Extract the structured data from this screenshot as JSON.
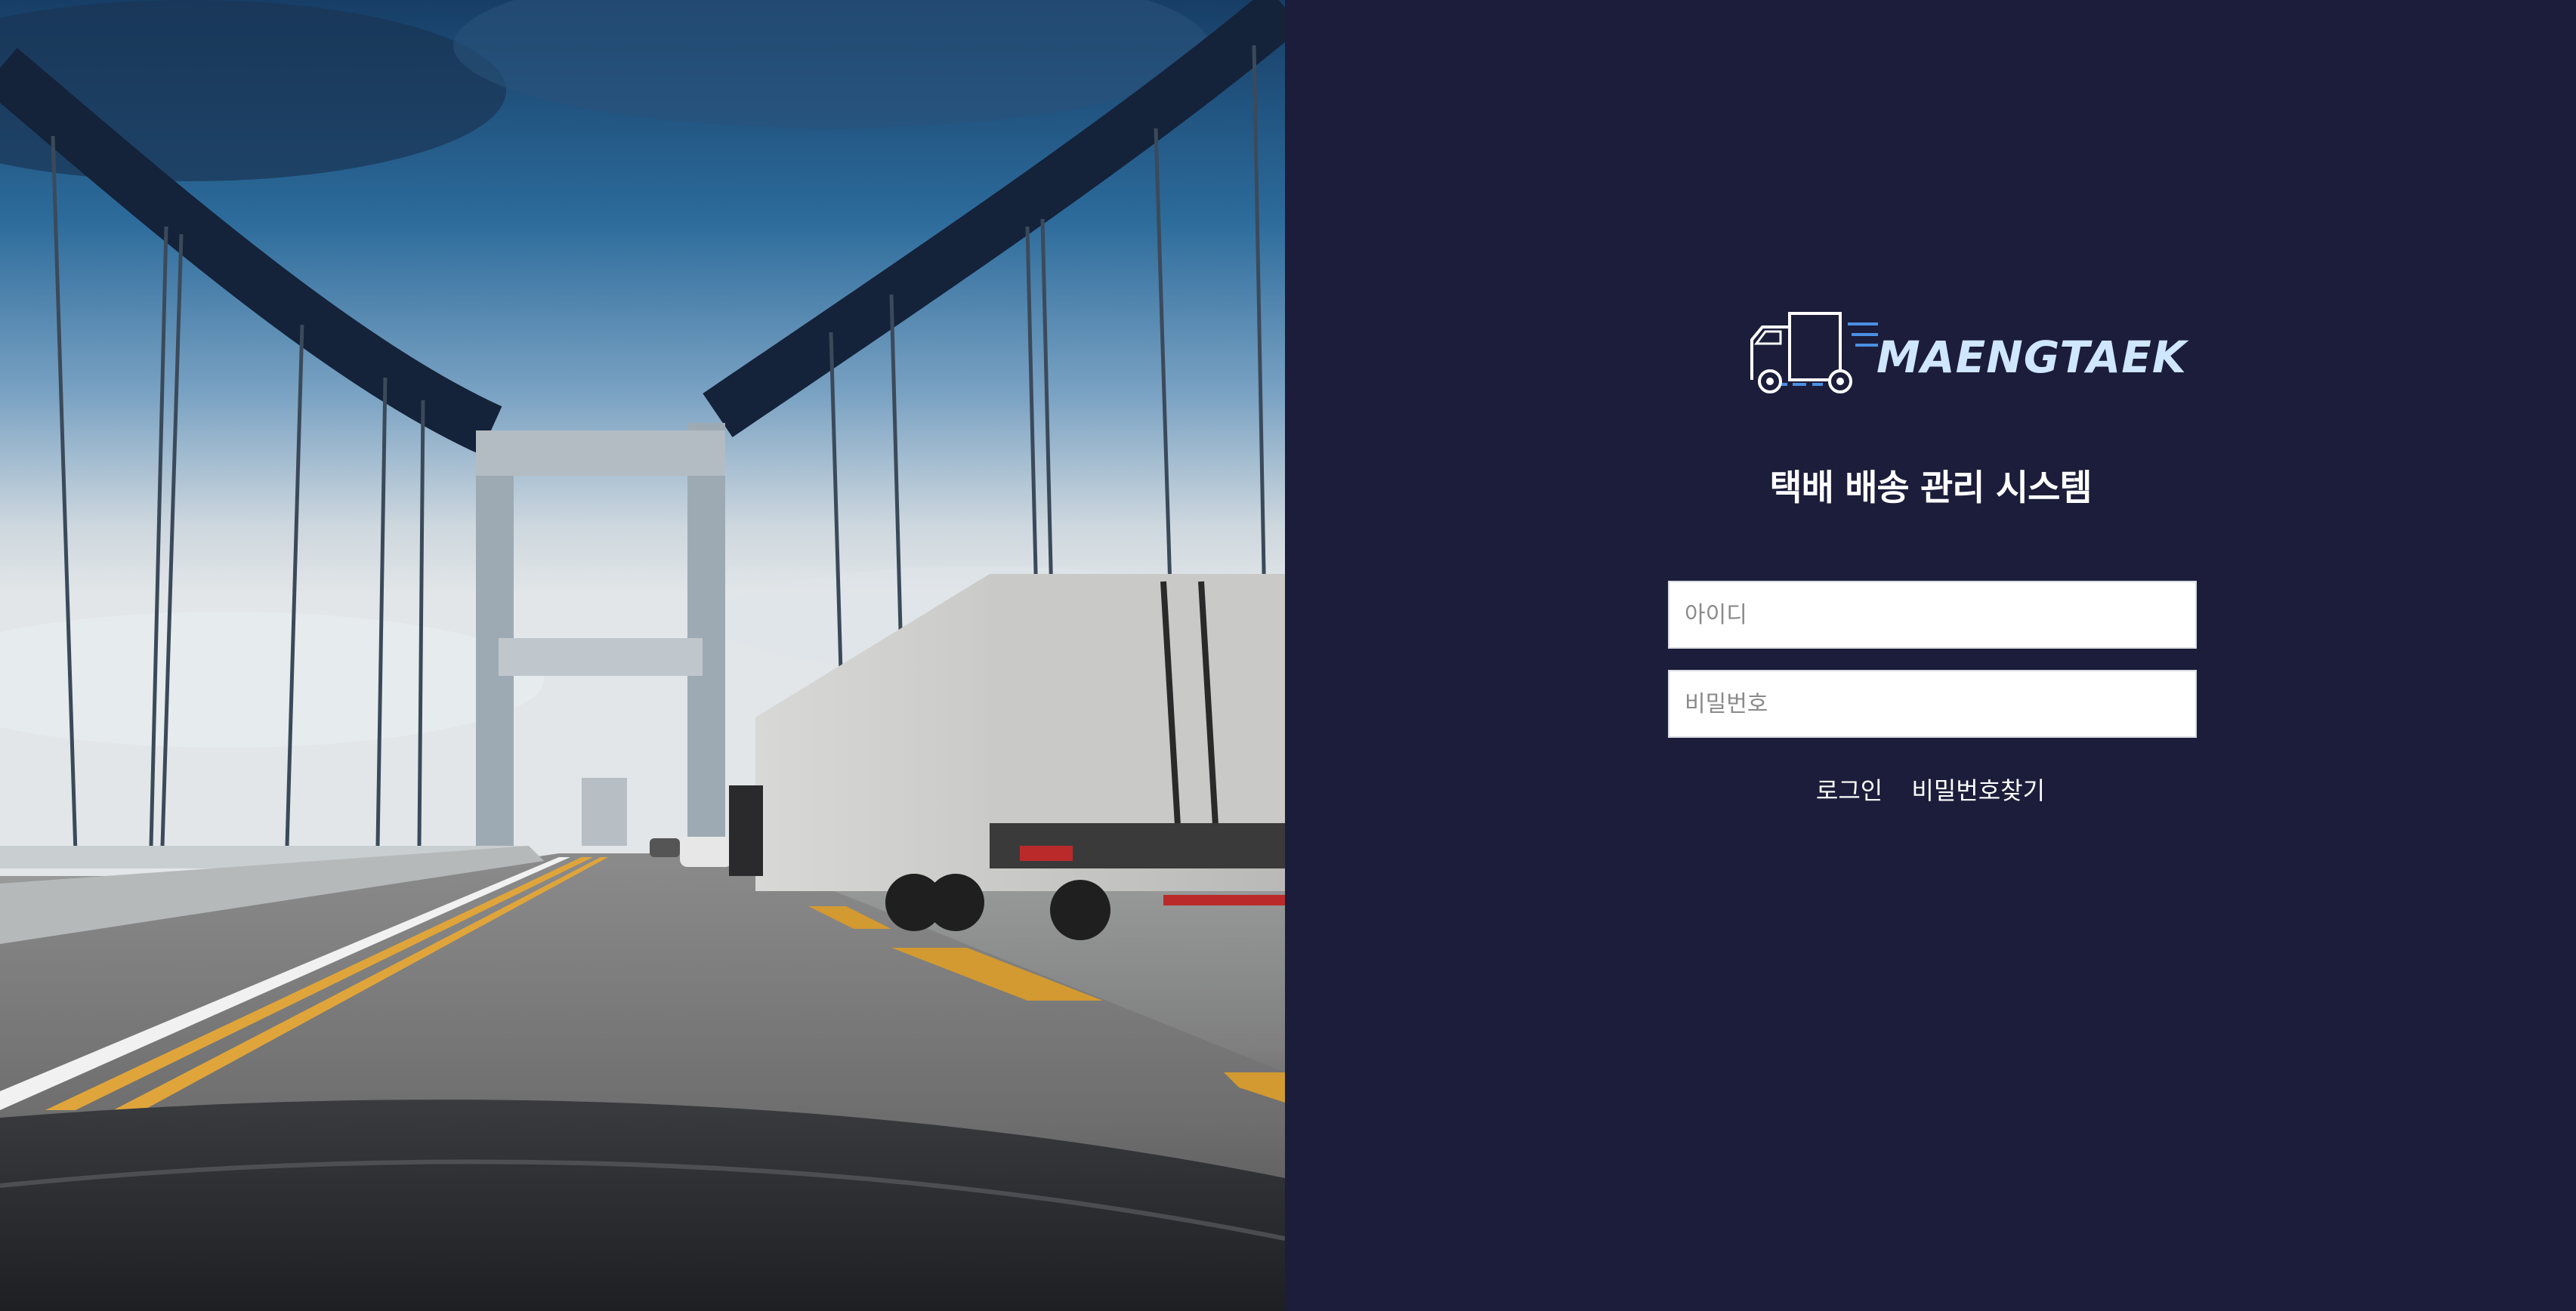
{
  "brand": {
    "logo_text": "MAENGTAEK",
    "logo_icon": "delivery-truck-icon",
    "accent_color": "#4a90e2",
    "logo_text_color": "#cfe6ff"
  },
  "title": "택배 배송 관리 시스템",
  "login_form": {
    "id_placeholder": "아이디",
    "id_value": "",
    "password_placeholder": "비밀번호",
    "password_value": ""
  },
  "actions": {
    "login_label": "로그인",
    "find_password_label": "비밀번호찾기"
  },
  "colors": {
    "panel_background": "#1b1d3a",
    "text": "#ffffff",
    "field_background": "#ffffff"
  },
  "hero": {
    "image": "bridge-highway-truck-photo"
  }
}
